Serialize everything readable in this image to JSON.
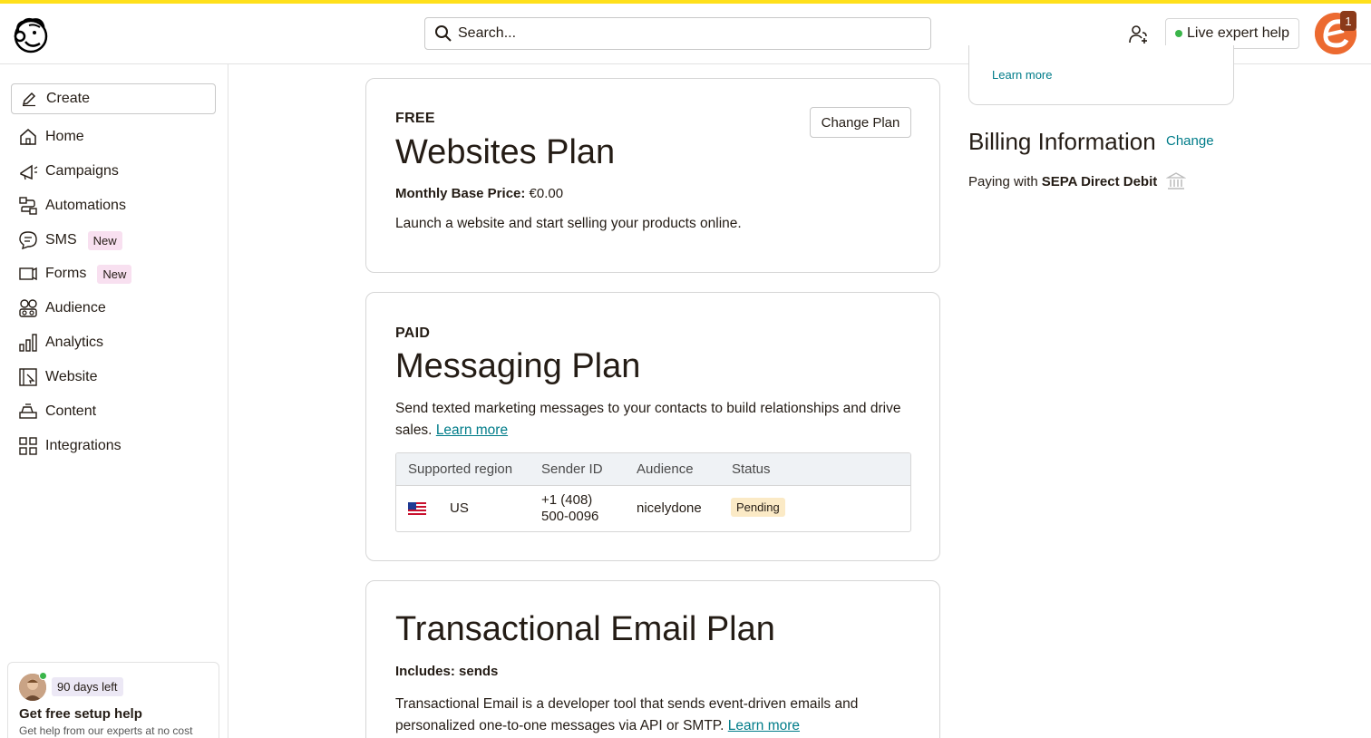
{
  "header": {
    "search_placeholder": "Search...",
    "expert_label": "Live expert help",
    "notification_count": "1"
  },
  "sidebar": {
    "create_label": "Create",
    "items": [
      {
        "label": "Home",
        "icon": "home-icon"
      },
      {
        "label": "Campaigns",
        "icon": "campaigns-icon"
      },
      {
        "label": "Automations",
        "icon": "automations-icon"
      },
      {
        "label": "SMS",
        "icon": "sms-icon",
        "badge": "New"
      },
      {
        "label": "Forms",
        "icon": "forms-icon",
        "badge": "New"
      },
      {
        "label": "Audience",
        "icon": "audience-icon"
      },
      {
        "label": "Analytics",
        "icon": "analytics-icon"
      },
      {
        "label": "Website",
        "icon": "website-icon"
      },
      {
        "label": "Content",
        "icon": "content-icon"
      },
      {
        "label": "Integrations",
        "icon": "integrations-icon"
      }
    ],
    "setup": {
      "days_left": "90 days left",
      "title": "Get free setup help",
      "subtitle": "Get help from our experts at no cost"
    }
  },
  "plans": {
    "websites": {
      "tier": "FREE",
      "title": "Websites Plan",
      "price_label": "Monthly Base Price:",
      "price_value": "€0.00",
      "description": "Launch a website and start selling your products online.",
      "change_label": "Change Plan"
    },
    "messaging": {
      "tier": "PAID",
      "title": "Messaging Plan",
      "description": "Send texted marketing messages to your contacts to build relationships and drive sales.",
      "learn_more": "Learn more",
      "table": {
        "headers": [
          "Supported region",
          "Sender ID",
          "Audience",
          "Status"
        ],
        "row": {
          "region": "US",
          "sender_line1": "+1 (408)",
          "sender_line2": "500-0096",
          "audience": "nicelydone",
          "status": "Pending"
        }
      }
    },
    "transactional": {
      "title": "Transactional Email Plan",
      "includes": "Includes: sends",
      "description": "Transactional Email is a developer tool that sends event-driven emails and personalized one-to-one messages via API or SMTP.",
      "learn_more": "Learn more"
    }
  },
  "right": {
    "top_learn_more": "Learn more",
    "billing_title": "Billing Information",
    "billing_change": "Change",
    "paying_prefix": "Paying with",
    "paying_method": "SEPA Direct Debit"
  },
  "colors": {
    "accent_yellow": "#ffe01b",
    "link_teal": "#007c89",
    "new_badge_bg": "#f8e0f0",
    "pending_bg": "#fbeac6",
    "avatar_orange": "#ec6a30"
  }
}
